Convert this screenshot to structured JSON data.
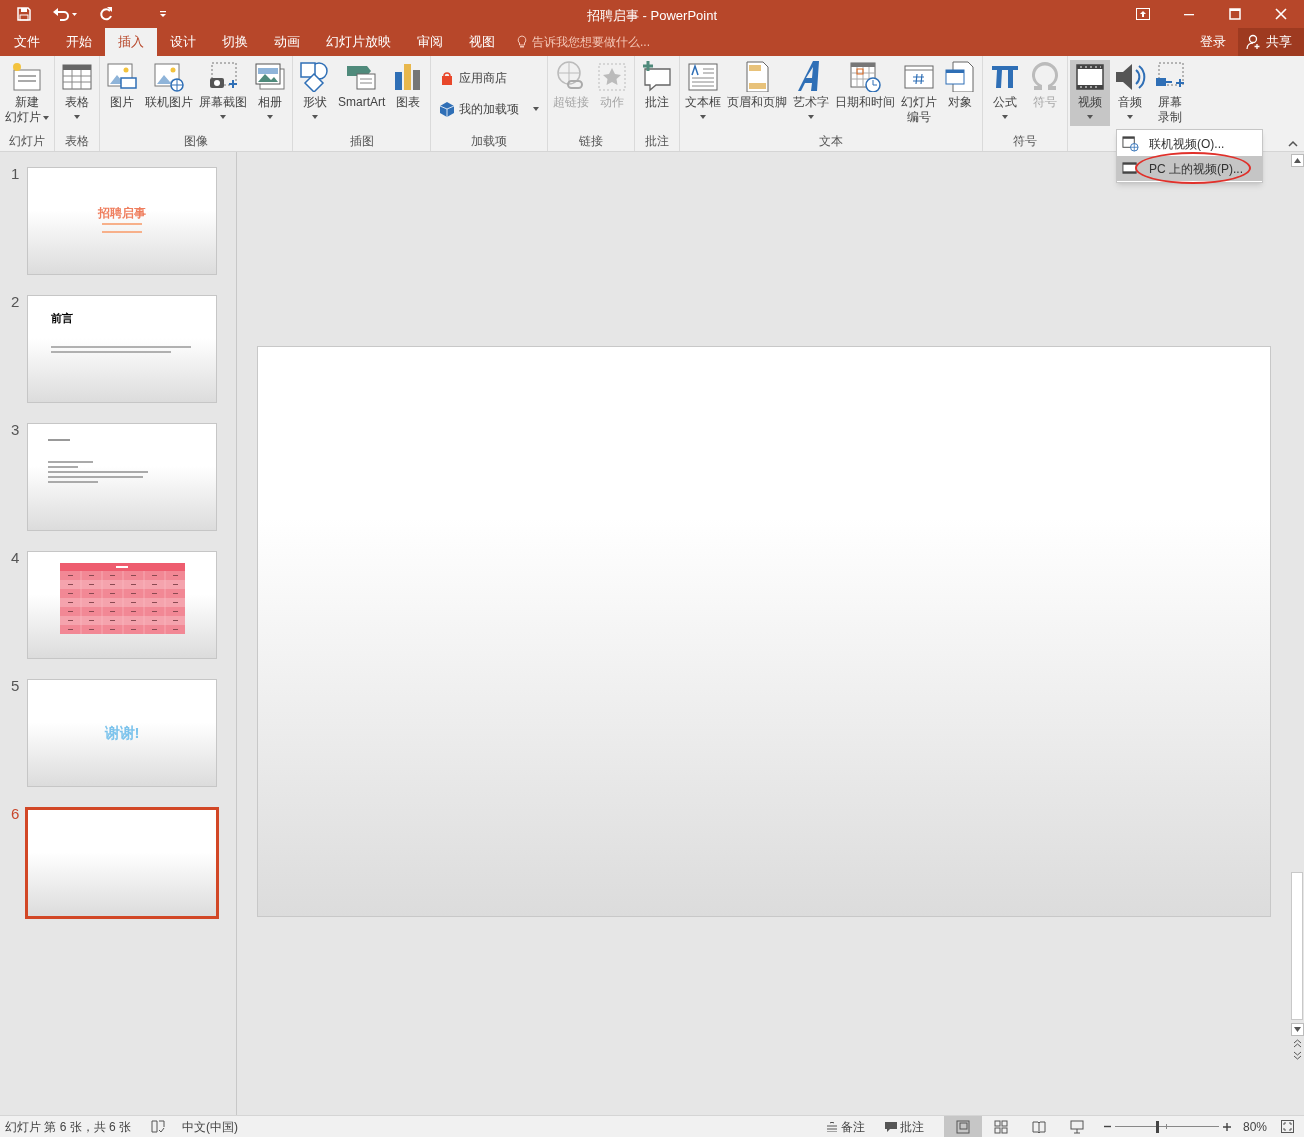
{
  "window": {
    "title": "招聘启事 - PowerPoint"
  },
  "tabs": [
    {
      "label": "文件",
      "selected": false
    },
    {
      "label": "开始",
      "selected": false
    },
    {
      "label": "插入",
      "selected": true
    },
    {
      "label": "设计",
      "selected": false
    },
    {
      "label": "切换",
      "selected": false
    },
    {
      "label": "动画",
      "selected": false
    },
    {
      "label": "幻灯片放映",
      "selected": false
    },
    {
      "label": "审阅",
      "selected": false
    },
    {
      "label": "视图",
      "selected": false
    }
  ],
  "tell_me": {
    "placeholder": "告诉我您想要做什么..."
  },
  "account": {
    "sign_in": "登录",
    "share": "共享"
  },
  "ribbon": [
    {
      "label": "幻灯片",
      "items": [
        {
          "kind": "large",
          "lines": [
            "新建",
            "幻灯片"
          ],
          "dropdown": true,
          "disabled": false,
          "selected": false
        }
      ]
    },
    {
      "label": "表格",
      "items": [
        {
          "kind": "large",
          "lines": [
            "表格"
          ],
          "dropdown": true,
          "disabled": false,
          "selected": false
        }
      ]
    },
    {
      "label": "图像",
      "items": [
        {
          "kind": "large",
          "lines": [
            "图片"
          ],
          "dropdown": false,
          "disabled": false,
          "selected": false
        },
        {
          "kind": "large",
          "lines": [
            "联机图片"
          ],
          "dropdown": false,
          "disabled": false,
          "selected": false
        },
        {
          "kind": "large",
          "lines": [
            "屏幕截图"
          ],
          "dropdown": true,
          "disabled": false,
          "selected": false
        },
        {
          "kind": "large",
          "lines": [
            "相册"
          ],
          "dropdown": true,
          "disabled": false,
          "selected": false
        }
      ]
    },
    {
      "label": "插图",
      "items": [
        {
          "kind": "large",
          "lines": [
            "形状"
          ],
          "dropdown": true,
          "disabled": false,
          "selected": false
        },
        {
          "kind": "large",
          "lines": [
            "SmartArt"
          ],
          "dropdown": false,
          "disabled": false,
          "selected": false
        },
        {
          "kind": "large",
          "lines": [
            "图表"
          ],
          "dropdown": false,
          "disabled": false,
          "selected": false
        }
      ]
    },
    {
      "label": "加载项",
      "items": [
        {
          "kind": "small",
          "lines": [
            "应用商店"
          ],
          "dropdown": false,
          "disabled": false,
          "selected": false
        },
        {
          "kind": "small",
          "lines": [
            "我的加载项"
          ],
          "dropdown": true,
          "disabled": false,
          "selected": false
        }
      ]
    },
    {
      "label": "链接",
      "items": [
        {
          "kind": "large",
          "lines": [
            "超链接"
          ],
          "dropdown": false,
          "disabled": true,
          "selected": false
        },
        {
          "kind": "large",
          "lines": [
            "动作"
          ],
          "dropdown": false,
          "disabled": true,
          "selected": false
        }
      ]
    },
    {
      "label": "批注",
      "items": [
        {
          "kind": "large",
          "lines": [
            "批注"
          ],
          "dropdown": false,
          "disabled": false,
          "selected": false
        }
      ]
    },
    {
      "label": "文本",
      "items": [
        {
          "kind": "large",
          "lines": [
            "文本框"
          ],
          "dropdown": true,
          "disabled": false,
          "selected": false
        },
        {
          "kind": "large",
          "lines": [
            "页眉和页脚"
          ],
          "dropdown": false,
          "disabled": false,
          "selected": false
        },
        {
          "kind": "large",
          "lines": [
            "艺术字"
          ],
          "dropdown": true,
          "disabled": false,
          "selected": false
        },
        {
          "kind": "large",
          "lines": [
            "日期和时间"
          ],
          "dropdown": false,
          "disabled": false,
          "selected": false
        },
        {
          "kind": "large",
          "lines": [
            "幻灯片",
            "编号"
          ],
          "dropdown": false,
          "disabled": false,
          "selected": false
        },
        {
          "kind": "large",
          "lines": [
            "对象"
          ],
          "dropdown": false,
          "disabled": false,
          "selected": false
        }
      ]
    },
    {
      "label": "符号",
      "items": [
        {
          "kind": "large",
          "lines": [
            "公式"
          ],
          "dropdown": true,
          "disabled": false,
          "selected": false
        },
        {
          "kind": "large",
          "lines": [
            "符号"
          ],
          "dropdown": false,
          "disabled": true,
          "selected": false
        }
      ]
    },
    {
      "items": [
        {
          "kind": "large",
          "lines": [
            "视频"
          ],
          "dropdown": true,
          "disabled": false,
          "selected": true
        },
        {
          "kind": "large",
          "lines": [
            "音频"
          ],
          "dropdown": true,
          "disabled": false,
          "selected": false
        },
        {
          "kind": "large",
          "lines": [
            "屏幕",
            "录制"
          ],
          "dropdown": false,
          "disabled": false,
          "selected": false
        }
      ]
    }
  ],
  "video_menu": [
    {
      "label": "联机视频(O)...",
      "selected": false
    },
    {
      "label": "PC 上的视频(P)...",
      "selected": true
    }
  ],
  "slides": [
    {
      "number": "1",
      "kind": "title",
      "title": "招聘启事",
      "selected": false
    },
    {
      "number": "2",
      "kind": "heading",
      "title": "前言",
      "selected": false
    },
    {
      "number": "3",
      "kind": "list",
      "selected": false
    },
    {
      "number": "4",
      "kind": "table",
      "selected": false
    },
    {
      "number": "5",
      "kind": "thanks",
      "title": "谢谢!",
      "selected": false
    },
    {
      "number": "6",
      "kind": "blank",
      "selected": true
    }
  ],
  "status_bar": {
    "slide_info": "幻灯片 第 6 张，共 6 张",
    "language": "中文(中国)",
    "notes": "备注",
    "comments": "批注",
    "views": [
      {
        "selected": true
      },
      {
        "selected": false
      },
      {
        "selected": false
      },
      {
        "selected": false
      }
    ],
    "zoom": {
      "level": 0.4,
      "reading": "80%"
    }
  }
}
